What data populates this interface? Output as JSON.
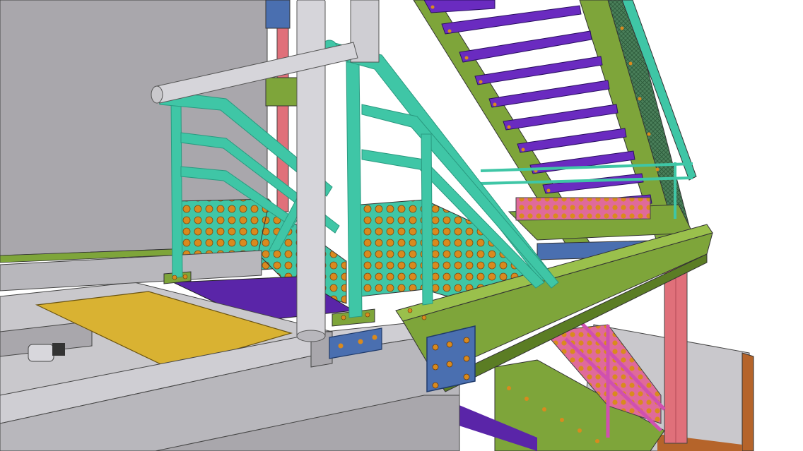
{
  "scene": {
    "subject": "structural-steel-stair-platform",
    "palette": {
      "background": "#ffffff",
      "wall_grey": "#a9a7ac",
      "wall_dark": "#8f8d93",
      "floor_light": "#c9c8cc",
      "beam_grey": "#b8b7bc",
      "column_steel": "#cfced3",
      "railing_teal": "#3fc6a6",
      "railing_teal_dark": "#2a9a80",
      "girder_green": "#7ea53a",
      "girder_green_dark": "#5b7d24",
      "stair_tread_purple": "#6a2bc0",
      "deck_purple": "#5a25a8",
      "support_pink": "#e0707a",
      "bolt_orange": "#d98a1e",
      "hatch_yellow": "#d9b232",
      "connection_plate_blue": "#4a6fb0",
      "magenta_rail": "#d050b0",
      "ground_brown": "#b5642a"
    }
  }
}
